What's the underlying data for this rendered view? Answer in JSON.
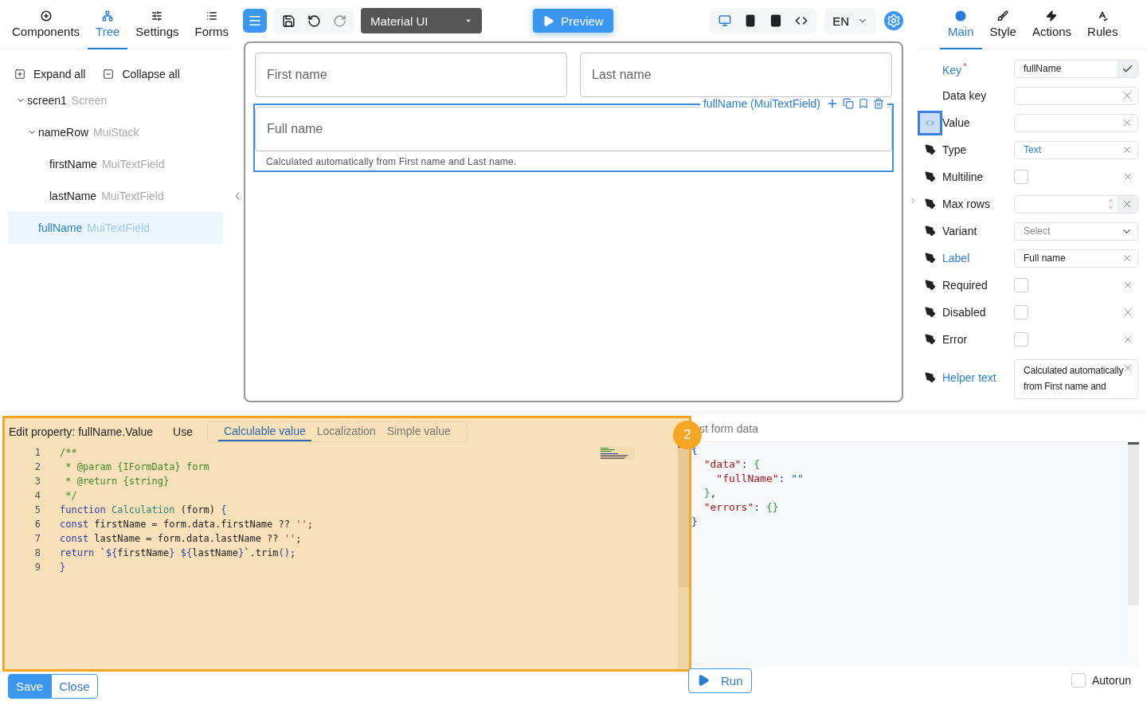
{
  "left_panel": {
    "tabs": [
      {
        "label": "Components",
        "selected": false
      },
      {
        "label": "Tree",
        "selected": true
      },
      {
        "label": "Settings",
        "selected": false
      },
      {
        "label": "Forms",
        "selected": false
      }
    ],
    "actions": [
      "Expand all",
      "Collapse all"
    ],
    "tree": [
      {
        "name": "screen1",
        "type": "Screen",
        "expanded": true,
        "selected": false,
        "children": [
          {
            "name": "nameRow",
            "type": "MuiStack",
            "expanded": true,
            "selected": false,
            "children": [
              {
                "name": "firstName",
                "type": "MuiTextField",
                "selected": false
              },
              {
                "name": "lastName",
                "type": "MuiTextField",
                "selected": false
              }
            ]
          },
          {
            "name": "fullName",
            "type": "MuiTextField",
            "selected": true
          }
        ]
      }
    ]
  },
  "toolbar": {
    "history": [
      {
        "disabled": false
      },
      {
        "disabled": false
      },
      {
        "disabled": true
      }
    ],
    "library": "Material UI",
    "preview": "Preview",
    "devices": [
      {
        "selected": true
      },
      {
        "selected": false
      },
      {
        "selected": false
      },
      {
        "selected": false
      }
    ],
    "language": "EN"
  },
  "canvas": {
    "row_fields": [
      {
        "label": "First name"
      },
      {
        "label": "Last name"
      }
    ],
    "selected_field": {
      "label": "Full name",
      "helper_text": "Calculated automatically from First name and Last name.",
      "tag": "fullName (MuiTextField)"
    }
  },
  "right_panel": {
    "tabs": [
      {
        "label": "Main",
        "selected": true
      },
      {
        "label": "Style",
        "selected": false
      },
      {
        "label": "Actions",
        "selected": false
      },
      {
        "label": "Rules",
        "selected": false
      }
    ],
    "properties": [
      {
        "kind": "text",
        "label": "Key",
        "mark": "*",
        "highlighted": true,
        "value": "fullName",
        "confirmed": true
      },
      {
        "kind": "text",
        "label": "Data key",
        "highlighted": false,
        "clearable": true
      },
      {
        "kind": "text",
        "label": "Value",
        "highlighted": false,
        "code_button_selected": true,
        "clearable": true
      },
      {
        "kind": "text",
        "label": "Type",
        "highlighted": false,
        "pen": true,
        "value": "Text",
        "value_highlighted": true,
        "clearable": true
      },
      {
        "kind": "checkbox",
        "label": "Multiline",
        "highlighted": false,
        "pen": true,
        "checked": false,
        "clearable": true
      },
      {
        "kind": "number",
        "label": "Max rows",
        "highlighted": false,
        "pen": true,
        "clearable": true
      },
      {
        "kind": "select",
        "label": "Variant",
        "highlighted": false,
        "pen": true,
        "placeholder": "Select"
      },
      {
        "kind": "text",
        "label": "Label",
        "highlighted": true,
        "pen": true,
        "value": "Full name",
        "clearable": true
      },
      {
        "kind": "checkbox",
        "label": "Required",
        "highlighted": false,
        "pen": true,
        "checked": false,
        "clearable": true
      },
      {
        "kind": "checkbox",
        "label": "Disabled",
        "highlighted": false,
        "pen": true,
        "checked": false,
        "clearable": true
      },
      {
        "kind": "checkbox",
        "label": "Error",
        "highlighted": false,
        "pen": true,
        "checked": false,
        "clearable": true
      },
      {
        "kind": "textarea",
        "label": "Helper text",
        "highlighted": true,
        "pen": true,
        "value": "Calculated automatically from First name and",
        "clearable": true
      }
    ]
  },
  "editor": {
    "title": "Edit property: fullName.Value",
    "use_label": "Use",
    "modes": [
      {
        "label": "Calculable value",
        "selected": true
      },
      {
        "label": "Localization",
        "selected": false
      },
      {
        "label": "Simple value",
        "selected": false
      }
    ],
    "lines": [
      {
        "number": "1",
        "tokens": [
          {
            "kind": "comment",
            "text": "/**"
          }
        ]
      },
      {
        "number": "2",
        "tokens": [
          {
            "kind": "comment",
            "text": " * @param {IFormData} form"
          }
        ]
      },
      {
        "number": "3",
        "tokens": [
          {
            "kind": "comment",
            "text": " * @return {string}"
          }
        ]
      },
      {
        "number": "4",
        "tokens": [
          {
            "kind": "comment",
            "text": " */"
          }
        ]
      },
      {
        "number": "5",
        "tokens": [
          {
            "kind": "keyword",
            "text": "function"
          },
          {
            "kind": "function",
            "text": " Calculation"
          },
          {
            "kind": "plain",
            "text": " (form) "
          },
          {
            "kind": "brace",
            "text": "{"
          }
        ]
      },
      {
        "number": "6",
        "tokens": [
          {
            "kind": "keyword",
            "text": "const"
          },
          {
            "kind": "plain",
            "text": " firstName = form.data.firstName ?? "
          },
          {
            "kind": "string",
            "text": "''"
          },
          {
            "kind": "plain",
            "text": ";"
          }
        ]
      },
      {
        "number": "7",
        "tokens": [
          {
            "kind": "keyword",
            "text": "const"
          },
          {
            "kind": "plain",
            "text": " lastName = form.data.lastName ?? "
          },
          {
            "kind": "string",
            "text": "''"
          },
          {
            "kind": "plain",
            "text": ";"
          }
        ]
      },
      {
        "number": "8",
        "tokens": [
          {
            "kind": "keyword",
            "text": "return"
          },
          {
            "kind": "plain",
            "text": " `"
          },
          {
            "kind": "brace",
            "text": "${"
          },
          {
            "kind": "plain",
            "text": "firstName"
          },
          {
            "kind": "brace",
            "text": "}"
          },
          {
            "kind": "brace",
            "text": " ${"
          },
          {
            "kind": "plain",
            "text": "lastName"
          },
          {
            "kind": "brace",
            "text": "}"
          },
          {
            "kind": "plain",
            "text": "`.trim"
          },
          {
            "kind": "brace",
            "text": "()"
          },
          {
            "kind": "plain",
            "text": ";"
          }
        ]
      },
      {
        "number": "9",
        "tokens": [
          {
            "kind": "brace",
            "text": "}"
          }
        ]
      }
    ],
    "buttons": [
      {
        "label": "Save",
        "kind": "primary"
      },
      {
        "label": "Close",
        "kind": "outline"
      }
    ]
  },
  "test_panel": {
    "title": "st form data",
    "lines": [
      [
        {
          "kind": "brace",
          "text": "{"
        }
      ],
      [
        {
          "kind": "key",
          "text": "  \"data\""
        },
        {
          "kind": "plain",
          "text": ": "
        },
        {
          "kind": "bracket",
          "text": "{"
        }
      ],
      [
        {
          "kind": "key",
          "text": "    \"fullName\""
        },
        {
          "kind": "plain",
          "text": ": "
        },
        {
          "kind": "value",
          "text": "\"\""
        }
      ],
      [
        {
          "kind": "bracket",
          "text": "  }"
        },
        {
          "kind": "plain",
          "text": ","
        }
      ],
      [
        {
          "kind": "key",
          "text": "  \"errors\""
        },
        {
          "kind": "plain",
          "text": ": "
        },
        {
          "kind": "bracket",
          "text": "{}"
        }
      ],
      [
        {
          "kind": "brace",
          "text": "}"
        }
      ]
    ],
    "run": "Run",
    "autorun": {
      "label": "Autorun",
      "checked": false
    }
  },
  "annotation": {
    "badge": "2"
  }
}
